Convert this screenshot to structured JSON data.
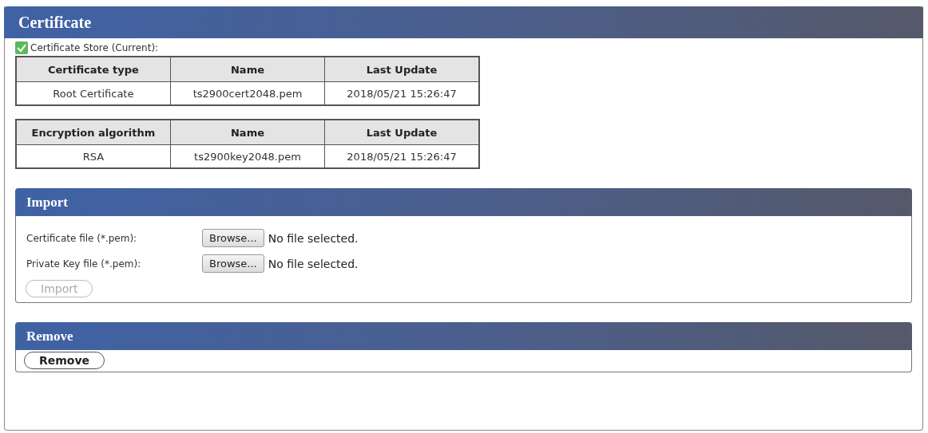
{
  "certificate": {
    "title": "Certificate",
    "store_label": "Certificate Store (Current):",
    "tables": [
      {
        "columns": [
          "Certificate type",
          "Name",
          "Last Update"
        ],
        "rows": [
          [
            "Root Certificate",
            "ts2900cert2048.pem",
            "2018/05/21 15:26:47"
          ]
        ]
      },
      {
        "columns": [
          "Encryption algorithm",
          "Name",
          "Last Update"
        ],
        "rows": [
          [
            "RSA",
            "ts2900key2048.pem",
            "2018/05/21 15:26:47"
          ]
        ]
      }
    ]
  },
  "import": {
    "title": "Import",
    "files": [
      {
        "label": "Certificate file (*.pem):",
        "button": "Browse...",
        "status": "No file selected."
      },
      {
        "label": "Private Key file (*.pem):",
        "button": "Browse...",
        "status": "No file selected."
      }
    ],
    "button": {
      "label": "Import",
      "disabled": true
    }
  },
  "remove": {
    "title": "Remove",
    "button": {
      "label": "Remove",
      "disabled": false
    }
  }
}
